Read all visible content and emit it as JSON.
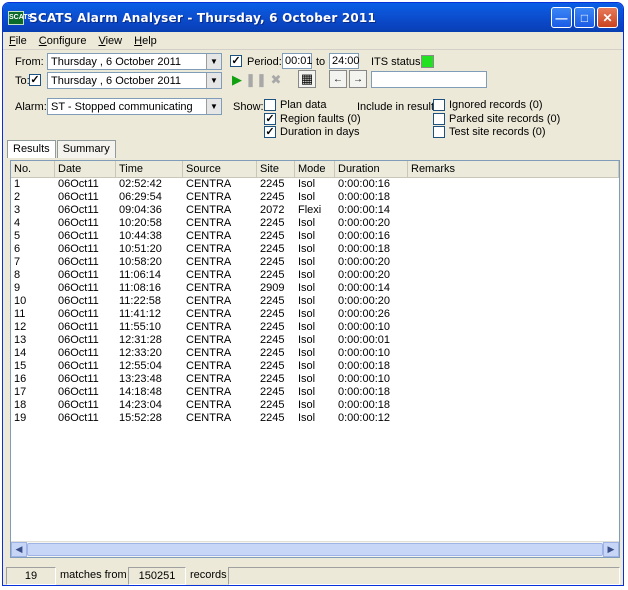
{
  "window": {
    "title": "SCATS Alarm Analyser - Thursday, 6 October 2011",
    "icon_text": "SCATS"
  },
  "menu": [
    "File",
    "Configure",
    "View",
    "Help"
  ],
  "filters": {
    "from_label": "From:",
    "from_date": "Thursday  ,   6   October   2011",
    "to_label": "To:",
    "to_date": "Thursday  ,   6   October   2011",
    "to_checked": true,
    "period_label": "Period:",
    "period_checked": true,
    "period_start": "00:01",
    "period_to": "to",
    "period_end": "24:00",
    "its_status_label": "ITS status:",
    "its_status_color": "#22e022",
    "alarm_label": "Alarm:",
    "alarm_value": "ST - Stopped communicating",
    "search_text": ""
  },
  "show": {
    "label": "Show:",
    "options": [
      {
        "label": "Plan data",
        "checked": false
      },
      {
        "label": "Region faults (0)",
        "checked": true
      },
      {
        "label": "Duration in days",
        "checked": true
      }
    ]
  },
  "include": {
    "label": "Include in results:",
    "options": [
      {
        "label": "Ignored records (0)",
        "checked": false
      },
      {
        "label": "Parked site records (0)",
        "checked": false
      },
      {
        "label": "Test site records (0)",
        "checked": false
      }
    ]
  },
  "tabs": [
    {
      "label": "Results",
      "active": true
    },
    {
      "label": "Summary",
      "active": false
    }
  ],
  "table": {
    "columns": [
      "No.",
      "Date",
      "Time",
      "Source",
      "Site",
      "Mode",
      "Duration",
      "Remarks"
    ],
    "rows": [
      [
        "1",
        "06Oct11",
        "02:52:42",
        "CENTRA",
        "2245",
        "Isol",
        "0:00:00:16",
        ""
      ],
      [
        "2",
        "06Oct11",
        "06:29:54",
        "CENTRA",
        "2245",
        "Isol",
        "0:00:00:18",
        ""
      ],
      [
        "3",
        "06Oct11",
        "09:04:36",
        "CENTRA",
        "2072",
        "Flexi",
        "0:00:00:14",
        ""
      ],
      [
        "4",
        "06Oct11",
        "10:20:58",
        "CENTRA",
        "2245",
        "Isol",
        "0:00:00:20",
        ""
      ],
      [
        "5",
        "06Oct11",
        "10:44:38",
        "CENTRA",
        "2245",
        "Isol",
        "0:00:00:16",
        ""
      ],
      [
        "6",
        "06Oct11",
        "10:51:20",
        "CENTRA",
        "2245",
        "Isol",
        "0:00:00:18",
        ""
      ],
      [
        "7",
        "06Oct11",
        "10:58:20",
        "CENTRA",
        "2245",
        "Isol",
        "0:00:00:20",
        ""
      ],
      [
        "8",
        "06Oct11",
        "11:06:14",
        "CENTRA",
        "2245",
        "Isol",
        "0:00:00:20",
        ""
      ],
      [
        "9",
        "06Oct11",
        "11:08:16",
        "CENTRA",
        "2909",
        "Isol",
        "0:00:00:14",
        ""
      ],
      [
        "10",
        "06Oct11",
        "11:22:58",
        "CENTRA",
        "2245",
        "Isol",
        "0:00:00:20",
        ""
      ],
      [
        "11",
        "06Oct11",
        "11:41:12",
        "CENTRA",
        "2245",
        "Isol",
        "0:00:00:26",
        ""
      ],
      [
        "12",
        "06Oct11",
        "11:55:10",
        "CENTRA",
        "2245",
        "Isol",
        "0:00:00:10",
        ""
      ],
      [
        "13",
        "06Oct11",
        "12:31:28",
        "CENTRA",
        "2245",
        "Isol",
        "0:00:00:01",
        ""
      ],
      [
        "14",
        "06Oct11",
        "12:33:20",
        "CENTRA",
        "2245",
        "Isol",
        "0:00:00:10",
        ""
      ],
      [
        "15",
        "06Oct11",
        "12:55:04",
        "CENTRA",
        "2245",
        "Isol",
        "0:00:00:18",
        ""
      ],
      [
        "16",
        "06Oct11",
        "13:23:48",
        "CENTRA",
        "2245",
        "Isol",
        "0:00:00:10",
        ""
      ],
      [
        "17",
        "06Oct11",
        "14:18:48",
        "CENTRA",
        "2245",
        "Isol",
        "0:00:00:18",
        ""
      ],
      [
        "18",
        "06Oct11",
        "14:23:04",
        "CENTRA",
        "2245",
        "Isol",
        "0:00:00:18",
        ""
      ],
      [
        "19",
        "06Oct11",
        "15:52:28",
        "CENTRA",
        "2245",
        "Isol",
        "0:00:00:12",
        ""
      ]
    ]
  },
  "status": {
    "matches": "19",
    "matches_from": "matches from",
    "total": "150251",
    "records": "records"
  }
}
